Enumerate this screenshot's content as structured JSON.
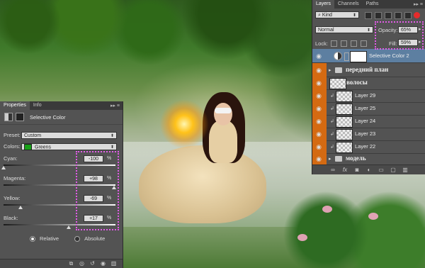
{
  "properties": {
    "tabs": [
      "Properties",
      "Info"
    ],
    "title": "Selective Color",
    "preset_label": "Preset:",
    "preset_value": "Custom",
    "colors_label": "Colors:",
    "colors_value": "Greens",
    "colors_swatch": "#18a018",
    "sliders": [
      {
        "label": "Cyan:",
        "value": "-100",
        "unit": "%",
        "level": 0.0
      },
      {
        "label": "Magenta:",
        "value": "+98",
        "unit": "%",
        "level": 0.99
      },
      {
        "label": "Yellow:",
        "value": "-69",
        "unit": "%",
        "level": 0.155
      },
      {
        "label": "Black:",
        "value": "+17",
        "unit": "%",
        "level": 0.585
      }
    ],
    "mode_options": [
      "Relative",
      "Absolute"
    ],
    "mode_selected": "Relative",
    "footer_icons": [
      "clip-to-layer-icon",
      "view-previous-icon",
      "reset-icon",
      "visibility-icon",
      "trash-icon"
    ]
  },
  "layers": {
    "tabs": [
      "Layers",
      "Channels",
      "Paths"
    ],
    "kind_label": "Kind",
    "blend_mode": "Normal",
    "opacity_label": "Opacity:",
    "opacity_value": "65%",
    "lock_label": "Lock:",
    "fill_label": "Fill:",
    "fill_value": "59%",
    "items": [
      {
        "name": "Selective Color 2",
        "type": "adjustment",
        "selected": true
      },
      {
        "name": "передний план",
        "type": "group"
      },
      {
        "name": "волосы",
        "type": "group-thumb"
      },
      {
        "name": "Layer 29",
        "type": "layer"
      },
      {
        "name": "Layer 25",
        "type": "layer"
      },
      {
        "name": "Layer 24",
        "type": "layer"
      },
      {
        "name": "Layer 23",
        "type": "layer"
      },
      {
        "name": "Layer 22",
        "type": "layer"
      },
      {
        "name": "модель",
        "type": "group"
      }
    ],
    "footer_icons": [
      "link-icon",
      "fx-icon",
      "mask-icon",
      "adjustment-icon",
      "folder-icon",
      "new-layer-icon",
      "trash-icon"
    ],
    "accent": "#d46a12",
    "selection": "#5d7fa1"
  },
  "annotation_color": "#e05be6"
}
